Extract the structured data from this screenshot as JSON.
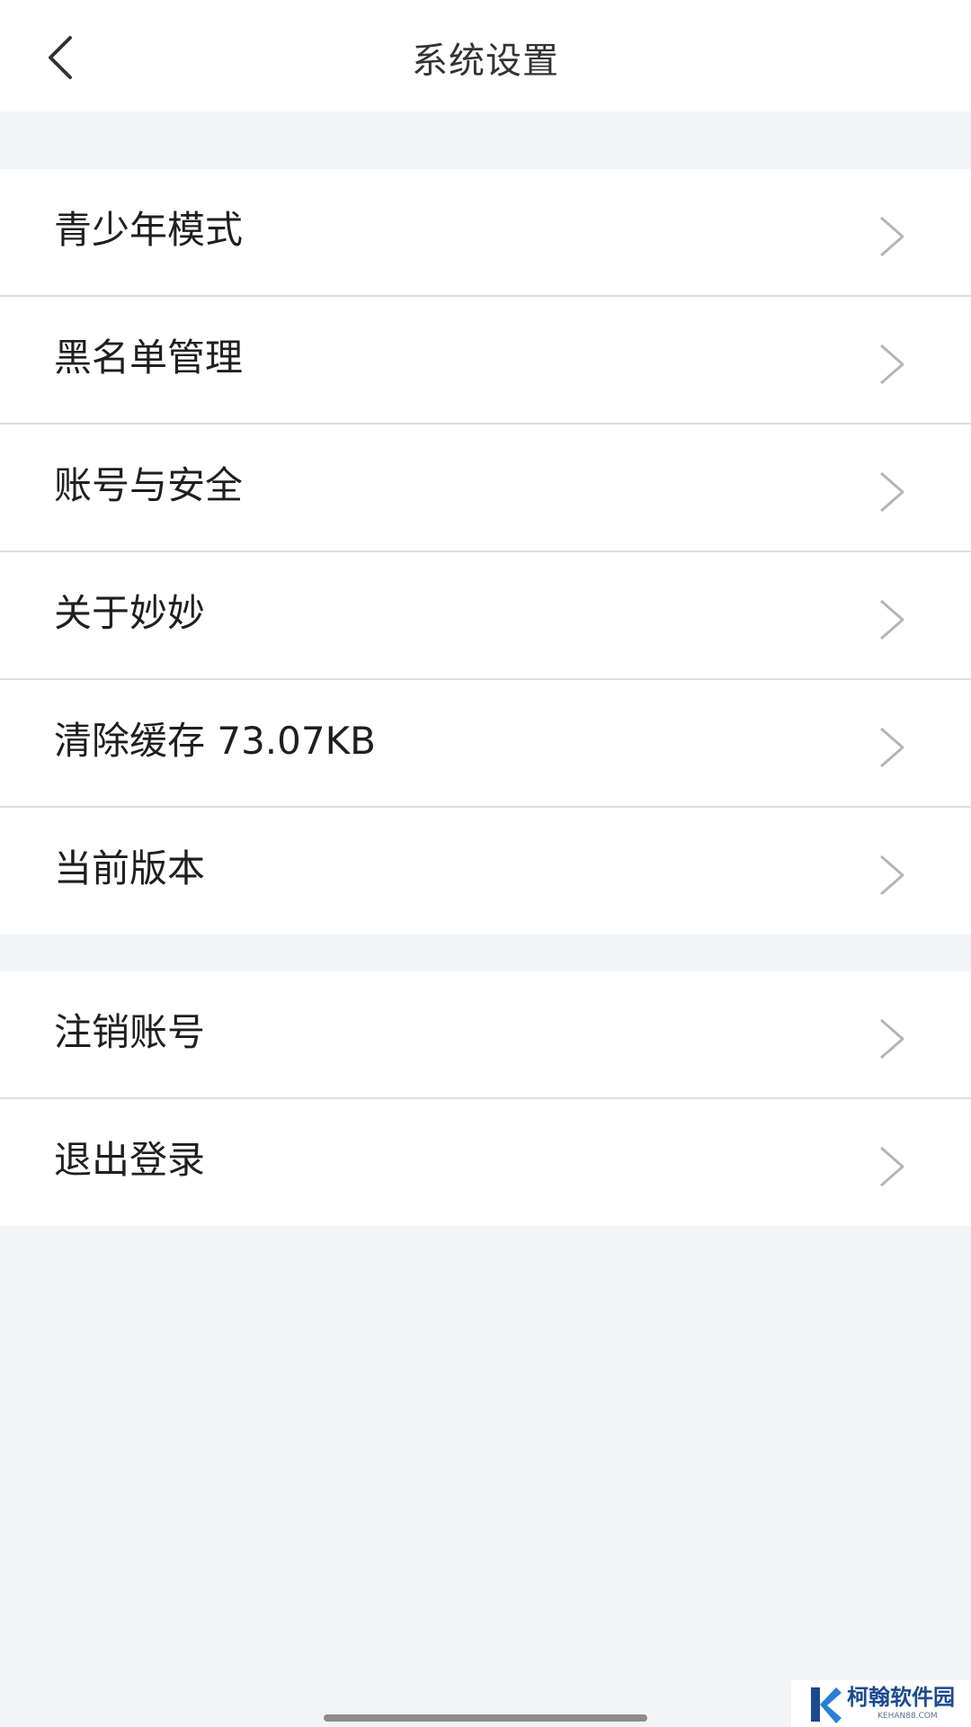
{
  "header": {
    "title": "系统设置",
    "back_icon": "chevron-left-icon"
  },
  "group1": [
    {
      "label": "青少年模式",
      "icon": "chevron-right-icon"
    },
    {
      "label": "黑名单管理",
      "icon": "chevron-right-icon"
    },
    {
      "label": "账号与安全",
      "icon": "chevron-right-icon"
    },
    {
      "label": "关于妙妙",
      "icon": "chevron-right-icon"
    },
    {
      "label": "清除缓存 73.07KB",
      "icon": "chevron-right-icon"
    },
    {
      "label": "当前版本",
      "icon": "chevron-right-icon"
    }
  ],
  "group2": [
    {
      "label": "注销账号",
      "icon": "chevron-right-icon"
    },
    {
      "label": "退出登录",
      "icon": "chevron-right-icon"
    }
  ],
  "watermark": {
    "name": "柯翰软件园",
    "url": "KEHAN88.COM"
  },
  "colors": {
    "background": "#f3f4f6",
    "surface": "#ffffff",
    "divider": "#dedede",
    "chevron": "#b5b5b5",
    "watermark_brand": "#1b4a8f"
  }
}
